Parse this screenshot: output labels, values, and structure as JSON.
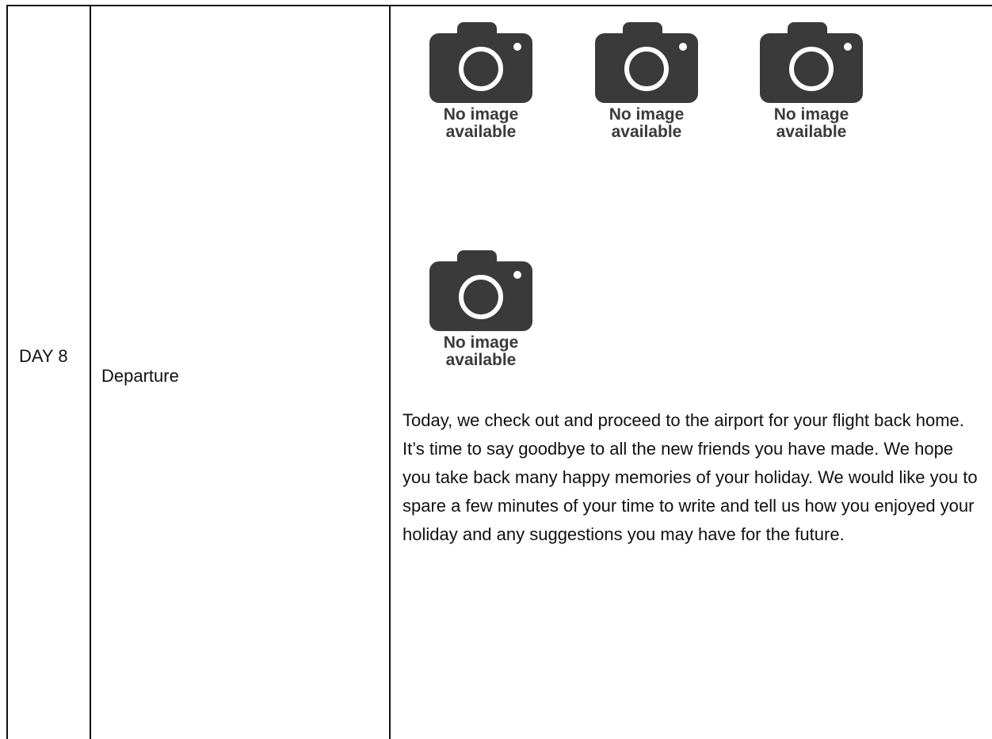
{
  "itinerary": {
    "day": "DAY 8",
    "title": "Departure",
    "images": [
      {
        "caption": "No image\navailable",
        "icon": "camera-icon"
      },
      {
        "caption": "No image\navailable",
        "icon": "camera-icon"
      },
      {
        "caption": "No image\navailable",
        "icon": "camera-icon"
      },
      {
        "caption": "No image\navailable",
        "icon": "camera-icon"
      }
    ],
    "description": "Today, we check out and proceed to the airport for your flight back home. It’s time to say goodbye to all the new friends you have made. We hope you take back many happy memories of your holiday. We would like you to spare a few minutes of your time to write and tell us how you enjoyed your holiday and any suggestions you may have for the future."
  },
  "colors": {
    "border": "#111111",
    "placeholder_icon": "#3a3a3a",
    "text": "#111111"
  }
}
